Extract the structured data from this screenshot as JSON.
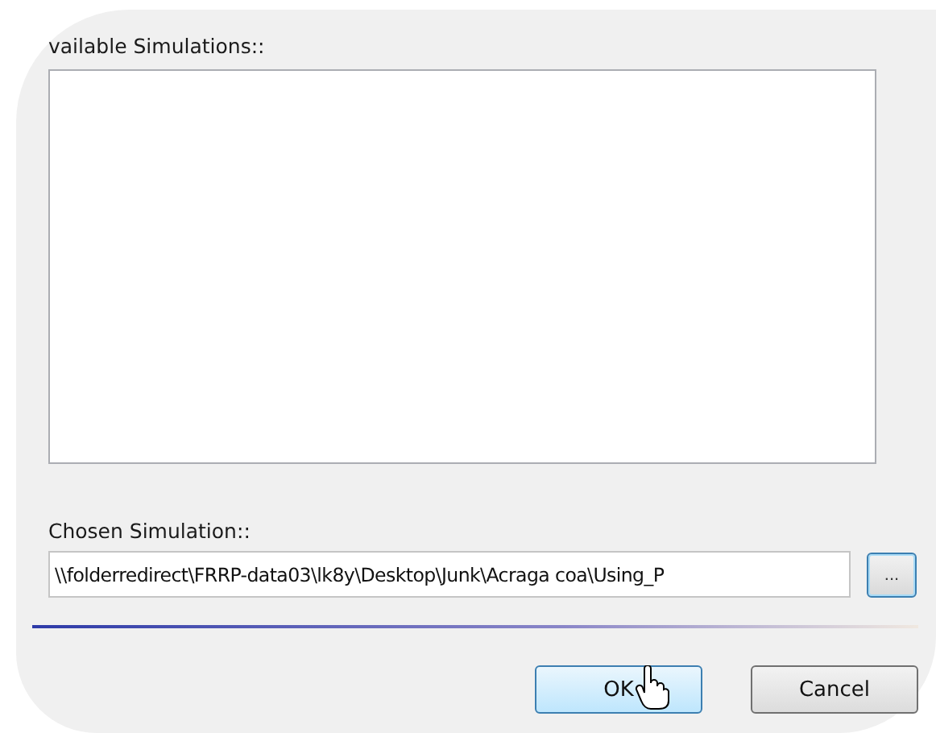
{
  "available_label": "vailable Simulations::",
  "chosen_label": "Chosen Simulation::",
  "chosen_path": "\\\\folderredirect\\FRRP-data03\\lk8y\\Desktop\\Junk\\Acraga coa\\Using_P",
  "browse_button": "...",
  "buttons": [
    {
      "label": "OK",
      "highlighted": true
    },
    {
      "label": "Cancel",
      "highlighted": false
    }
  ]
}
